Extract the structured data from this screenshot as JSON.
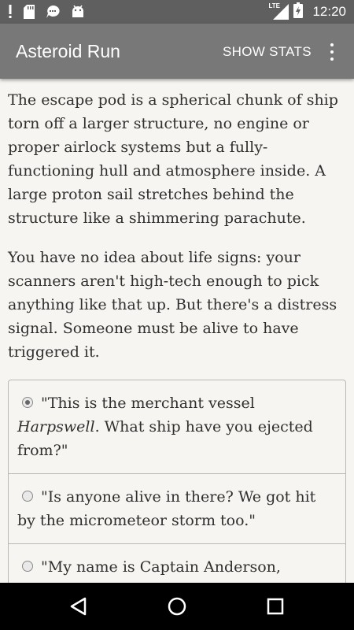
{
  "status_bar": {
    "time": "12:20",
    "network_label": "LTE",
    "icons": [
      "alert-icon",
      "sd-card-icon",
      "chat-icon",
      "android-icon",
      "signal-icon",
      "battery-icon"
    ]
  },
  "app_bar": {
    "title": "Asteroid Run",
    "action": "SHOW STATS",
    "overflow_icon": "more-vert-icon"
  },
  "content": {
    "paragraphs": [
      "The escape pod is a spherical chunk of ship torn off a larger structure, no engine or proper airlock systems but a fully-functioning hull and atmosphere inside. A large proton sail stretches behind the structure like a shimmering parachute.",
      "You have no idea about life signs: your scanners aren't high-tech enough to pick anything like that up. But there's a distress signal. Someone must be alive to have triggered it."
    ],
    "choices": [
      {
        "before": "\"This is the merchant vessel ",
        "emphasis": "Harpswell",
        "after": ". What ship have you ejected from?\"",
        "selected": true
      },
      {
        "before": "\"Is anyone alive in there? We got hit by the micrometeor storm too.\"",
        "emphasis": "",
        "after": "",
        "selected": false
      },
      {
        "before": "\"My name is Captain Anderson, answering your distress signal. How can",
        "emphasis": "",
        "after": "",
        "selected": false
      }
    ]
  },
  "nav_bar": {
    "icons": [
      "back-icon",
      "home-icon",
      "recents-icon"
    ]
  },
  "colors": {
    "status_bar": "#5f5f5f",
    "app_bar": "#787878",
    "background": "#f7f5f1",
    "text": "#2f2f2f",
    "nav_bar": "#000000"
  }
}
